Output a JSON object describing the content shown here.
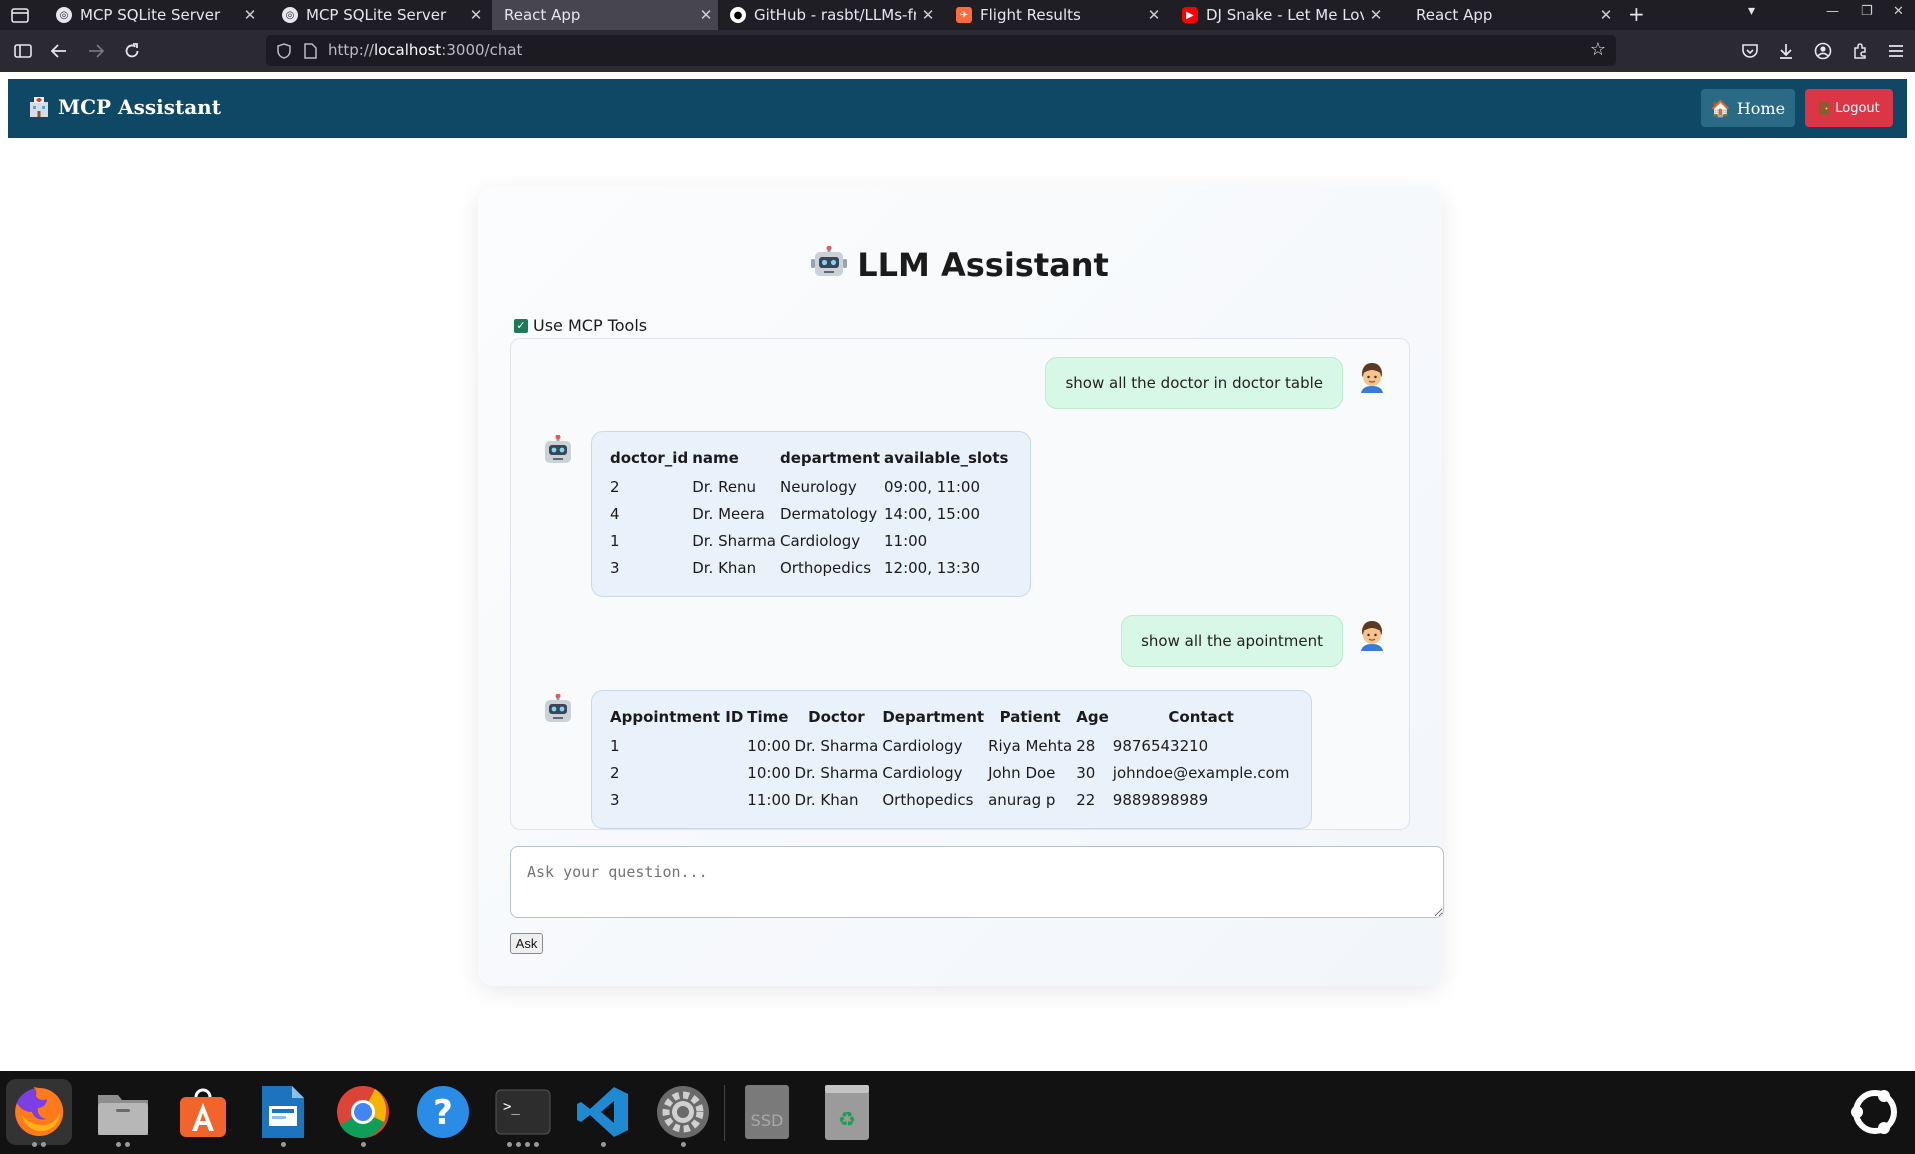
{
  "browser": {
    "tabs": [
      {
        "title": "MCP SQLite Server",
        "active": false
      },
      {
        "title": "MCP SQLite Server",
        "active": false
      },
      {
        "title": "React App",
        "active": true
      },
      {
        "title": "GitHub - rasbt/LLMs-from",
        "active": false
      },
      {
        "title": "Flight Results",
        "active": false
      },
      {
        "title": "DJ Snake - Let Me Love Yo",
        "active": false
      },
      {
        "title": "React App",
        "active": false
      }
    ],
    "url_prefix": "http://",
    "url_host": "localhost",
    "url_rest": ":3000/chat"
  },
  "header": {
    "brand": "MCP Assistant",
    "home_label": "Home",
    "logout_label": "Logout"
  },
  "chat": {
    "title": "LLM Assistant",
    "use_mcp_label": "Use MCP Tools",
    "use_mcp_checked": true,
    "messages": [
      {
        "role": "user",
        "text": "show all the doctor in doctor table"
      },
      {
        "role": "bot",
        "table": {
          "headers": [
            "doctor_id",
            "name",
            "department",
            "available_slots"
          ],
          "rows": [
            [
              "2",
              "Dr. Renu",
              "Neurology",
              "09:00, 11:00"
            ],
            [
              "4",
              "Dr. Meera",
              "Dermatology",
              "14:00, 15:00"
            ],
            [
              "1",
              "Dr. Sharma",
              "Cardiology",
              "11:00"
            ],
            [
              "3",
              "Dr. Khan",
              "Orthopedics",
              "12:00, 13:30"
            ]
          ]
        }
      },
      {
        "role": "user",
        "text": "show all the apointment"
      },
      {
        "role": "bot",
        "table": {
          "headers": [
            "Appointment ID",
            "Time",
            "Doctor",
            "Department",
            "Patient",
            "Age",
            "Contact"
          ],
          "rows": [
            [
              "1",
              "10:00",
              "Dr. Sharma",
              "Cardiology",
              "Riya Mehta",
              "28",
              "9876543210"
            ],
            [
              "2",
              "10:00",
              "Dr. Sharma",
              "Cardiology",
              "John Doe",
              "30",
              "johndoe@example.com"
            ],
            [
              "3",
              "11:00",
              "Dr. Khan",
              "Orthopedics",
              "anurag p",
              "22",
              "9889898989"
            ]
          ]
        }
      }
    ],
    "input_placeholder": "Ask your question...",
    "ask_label": "Ask"
  },
  "dock": {
    "items": [
      "firefox-icon",
      "files-icon",
      "app-center-icon",
      "libreoffice-impress-icon",
      "chrome-icon",
      "help-icon",
      "terminal-icon",
      "vscode-icon",
      "settings-icon",
      "ssd-drive-icon",
      "trash-icon"
    ],
    "show_apps_icon": "show-apps-icon"
  }
}
